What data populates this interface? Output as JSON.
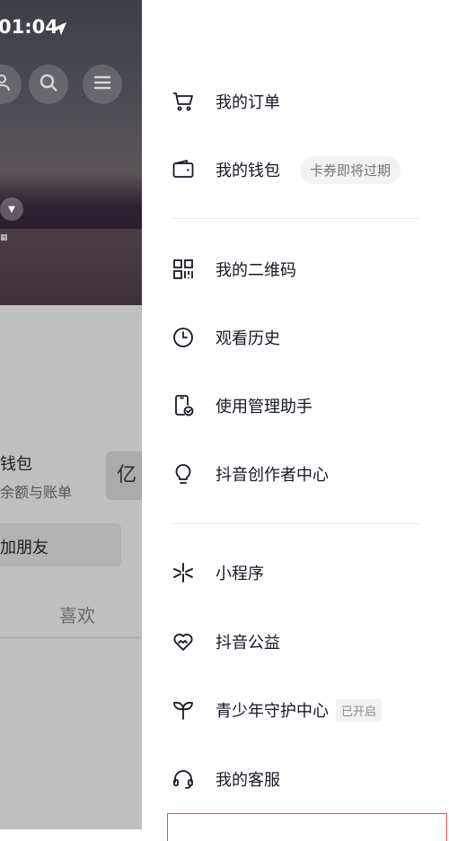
{
  "status_bar": {
    "time": "01:04"
  },
  "background": {
    "wallet_title": "钱包",
    "wallet_subtitle": "余额与账单",
    "qr_glyph": "亿",
    "add_friend_label": "加朋友",
    "likes_tab": "喜欢"
  },
  "drawer": {
    "items": [
      {
        "label": "我的订单",
        "icon": "cart-icon"
      },
      {
        "label": "我的钱包",
        "icon": "wallet-icon",
        "badge": "卡券即将过期"
      },
      {
        "label": "我的二维码",
        "icon": "qr-code-icon"
      },
      {
        "label": "观看历史",
        "icon": "clock-icon"
      },
      {
        "label": "使用管理助手",
        "icon": "phone-check-icon"
      },
      {
        "label": "抖音创作者中心",
        "icon": "lightbulb-icon"
      },
      {
        "label": "小程序",
        "icon": "mini-program-icon"
      },
      {
        "label": "抖音公益",
        "icon": "heart-hands-icon"
      },
      {
        "label": "青少年守护中心",
        "icon": "sprout-icon",
        "badge": "已开启"
      },
      {
        "label": "我的客服",
        "icon": "headset-icon"
      }
    ]
  },
  "colors": {
    "text": "#161823",
    "highlight_border": "#e0553f",
    "badge_bg": "#f2f2f2"
  }
}
